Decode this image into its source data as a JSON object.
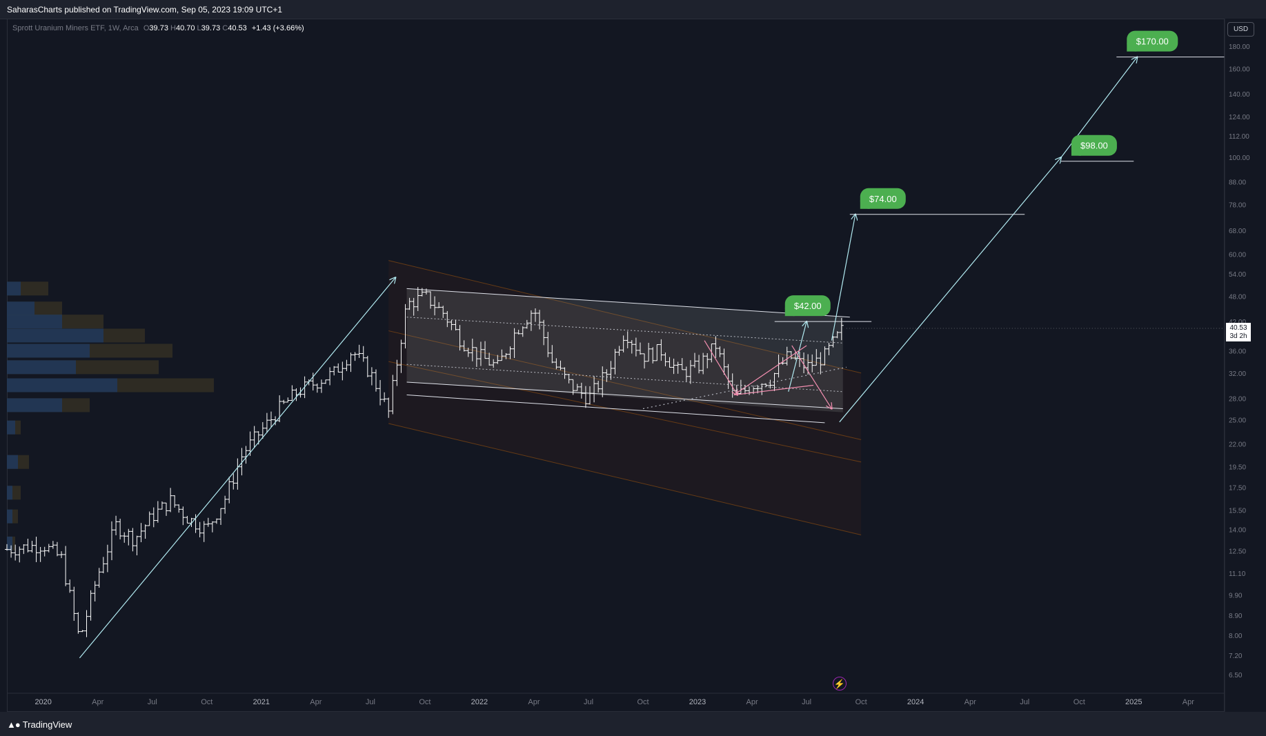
{
  "header": {
    "publisher_line": "SaharasCharts published on TradingView.com, Sep 05, 2023 19:09 UTC+1"
  },
  "legend": {
    "symbol": "Sprott Uranium Miners ETF, 1W, Arca",
    "o_label": "O",
    "open": "39.73",
    "h_label": "H",
    "high": "40.70",
    "l_label": "L",
    "low": "39.73",
    "c_label": "C",
    "close": "40.53",
    "change": "+1.43 (+3.66%)"
  },
  "price_axis": {
    "currency": "USD",
    "last_price": "40.53",
    "countdown": "3d 2h"
  },
  "footer": {
    "brand": "TradingView"
  },
  "colors": {
    "background": "#131722",
    "target_label_bg": "#4caf50",
    "arrow_line": "#b2ebf2",
    "channel_orange": "#f57c00",
    "arrow_pink": "#f48fb1",
    "candle": "#ffffff"
  },
  "chart_data": {
    "type": "ohlc",
    "title": "Sprott Uranium Miners ETF, 1W, Arca",
    "scale": "log",
    "ylim": [
      6.0,
      195
    ],
    "y_ticks": [
      "180.00",
      "160.00",
      "140.00",
      "124.00",
      "112.00",
      "100.00",
      "88.00",
      "78.00",
      "68.00",
      "60.00",
      "54.00",
      "48.00",
      "42.00",
      "36.00",
      "32.00",
      "28.00",
      "25.00",
      "22.00",
      "19.50",
      "17.50",
      "15.50",
      "14.00",
      "12.50",
      "11.10",
      "9.90",
      "8.90",
      "8.00",
      "7.20",
      "6.50"
    ],
    "x_ticks": [
      "2020",
      "Apr",
      "Jul",
      "Oct",
      "2021",
      "Apr",
      "Jul",
      "Oct",
      "2022",
      "Apr",
      "Jul",
      "Oct",
      "2023",
      "Apr",
      "Jul",
      "Oct",
      "2024",
      "Apr",
      "Jul",
      "Oct",
      "2025",
      "Apr"
    ],
    "x_start": "2019-11",
    "x_end": "2025-06",
    "price_path": [
      [
        "2019-11",
        12.6
      ],
      [
        "2020-01",
        12.9
      ],
      [
        "2020-02",
        12.0
      ],
      [
        "2020-03",
        7.8
      ],
      [
        "2020-04",
        11.0
      ],
      [
        "2020-05",
        14.3
      ],
      [
        "2020-06",
        13.3
      ],
      [
        "2020-07",
        15.0
      ],
      [
        "2020-08",
        16.3
      ],
      [
        "2020-09",
        14.8
      ],
      [
        "2020-10",
        14.0
      ],
      [
        "2020-11",
        16.5
      ],
      [
        "2020-12",
        21.0
      ],
      [
        "2021-02",
        26.5
      ],
      [
        "2021-03",
        29.0
      ],
      [
        "2021-05",
        32.0
      ],
      [
        "2021-06",
        36.0
      ],
      [
        "2021-07",
        32.0
      ],
      [
        "2021-08",
        26.0
      ],
      [
        "2021-09",
        46.0
      ],
      [
        "2021-10",
        48.0
      ],
      [
        "2021-11",
        44.0
      ],
      [
        "2021-12",
        38.0
      ],
      [
        "2022-01",
        35.0
      ],
      [
        "2022-02",
        33.0
      ],
      [
        "2022-03",
        40.0
      ],
      [
        "2022-04",
        45.0
      ],
      [
        "2022-05",
        34.0
      ],
      [
        "2022-06",
        30.0
      ],
      [
        "2022-07",
        28.0
      ],
      [
        "2022-08",
        32.0
      ],
      [
        "2022-09",
        40.0
      ],
      [
        "2022-10",
        35.0
      ],
      [
        "2022-11",
        36.0
      ],
      [
        "2022-12",
        32.0
      ],
      [
        "2023-01",
        33.0
      ],
      [
        "2023-02",
        37.0
      ],
      [
        "2023-03",
        28.0
      ],
      [
        "2023-04",
        30.0
      ],
      [
        "2023-05",
        31.0
      ],
      [
        "2023-06",
        35.0
      ],
      [
        "2023-07",
        33.0
      ],
      [
        "2023-08",
        35.0
      ],
      [
        "2023-09",
        40.5
      ]
    ],
    "targets": [
      {
        "label": "$42.00",
        "value": 42
      },
      {
        "label": "$74.00",
        "value": 74
      },
      {
        "label": "$98.00",
        "value": 98
      },
      {
        "label": "$170.00",
        "value": 170
      }
    ],
    "last": {
      "value": 40.53,
      "label": "40.53",
      "countdown": "3d 2h"
    }
  }
}
